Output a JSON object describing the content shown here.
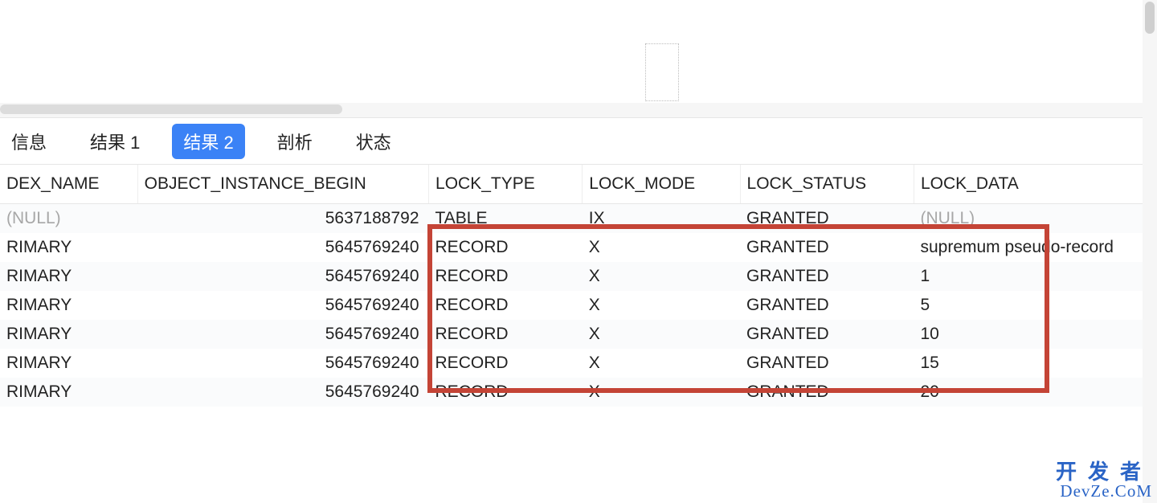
{
  "tabs": {
    "info": "信息",
    "result1": "结果 1",
    "result2": "结果 2",
    "profile": "剖析",
    "status": "状态",
    "active": "result2"
  },
  "columns": {
    "index_name": "DEX_NAME",
    "object_instance_begin": "OBJECT_INSTANCE_BEGIN",
    "lock_type": "LOCK_TYPE",
    "lock_mode": "LOCK_MODE",
    "lock_status": "LOCK_STATUS",
    "lock_data": "LOCK_DATA"
  },
  "rows": [
    {
      "index_name": "(NULL)",
      "index_name_null": true,
      "obj_inst": "5637188792",
      "lock_type": "TABLE",
      "lock_mode": "IX",
      "lock_status": "GRANTED",
      "lock_data": "(NULL)",
      "lock_data_null": true
    },
    {
      "index_name": "RIMARY",
      "obj_inst": "5645769240",
      "lock_type": "RECORD",
      "lock_mode": "X",
      "lock_status": "GRANTED",
      "lock_data": "supremum pseudo-record"
    },
    {
      "index_name": "RIMARY",
      "obj_inst": "5645769240",
      "lock_type": "RECORD",
      "lock_mode": "X",
      "lock_status": "GRANTED",
      "lock_data": "1"
    },
    {
      "index_name": "RIMARY",
      "obj_inst": "5645769240",
      "lock_type": "RECORD",
      "lock_mode": "X",
      "lock_status": "GRANTED",
      "lock_data": "5"
    },
    {
      "index_name": "RIMARY",
      "obj_inst": "5645769240",
      "lock_type": "RECORD",
      "lock_mode": "X",
      "lock_status": "GRANTED",
      "lock_data": "10"
    },
    {
      "index_name": "RIMARY",
      "obj_inst": "5645769240",
      "lock_type": "RECORD",
      "lock_mode": "X",
      "lock_status": "GRANTED",
      "lock_data": "15"
    },
    {
      "index_name": "RIMARY",
      "obj_inst": "5645769240",
      "lock_type": "RECORD",
      "lock_mode": "X",
      "lock_status": "GRANTED",
      "lock_data": "20"
    }
  ],
  "watermark": {
    "line1": "开发者",
    "line2": "DevZe.CoM"
  }
}
